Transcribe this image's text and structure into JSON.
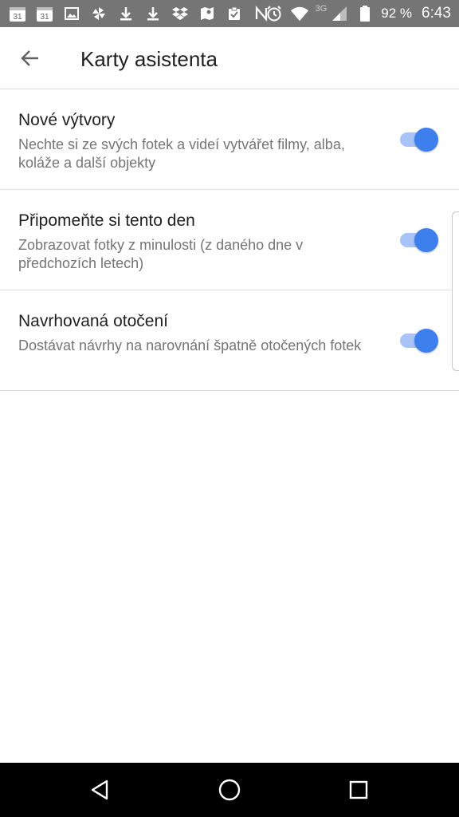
{
  "status_bar": {
    "network_type": "3G",
    "battery_percent": "92 %",
    "time": "6:43",
    "icons": [
      "calendar-icon",
      "calendar-icon",
      "image-icon",
      "pinwheel-icon",
      "download-icon",
      "download-icon",
      "dropbox-icon",
      "maps-icon",
      "clipboard-check-icon",
      "nfc-icon",
      "alarm-icon",
      "wifi-icon",
      "signal-icon",
      "battery-icon"
    ],
    "calendar_day": "31"
  },
  "app_bar": {
    "title": "Karty asistenta",
    "back_icon": "arrow-left-icon"
  },
  "settings": [
    {
      "title": "Nové výtvory",
      "description": "Nechte si ze svých fotek a videí vytvářet filmy, alba, koláže a další objekty",
      "enabled": true
    },
    {
      "title": "Připomeňte si tento den",
      "description": "Zobrazovat fotky z minulosti (z daného dne v předchozích letech)",
      "enabled": true
    },
    {
      "title": "Navrhovaná otočení",
      "description": "Dostávat návrhy na narovnání špatně otočených fotek",
      "enabled": true
    }
  ],
  "colors": {
    "accent": "#3d7fec",
    "toggle_track": "#a7c3f8",
    "status_bar": "#757575"
  },
  "nav_bar": {
    "icons": [
      "back-triangle-icon",
      "home-circle-icon",
      "recents-square-icon"
    ]
  }
}
